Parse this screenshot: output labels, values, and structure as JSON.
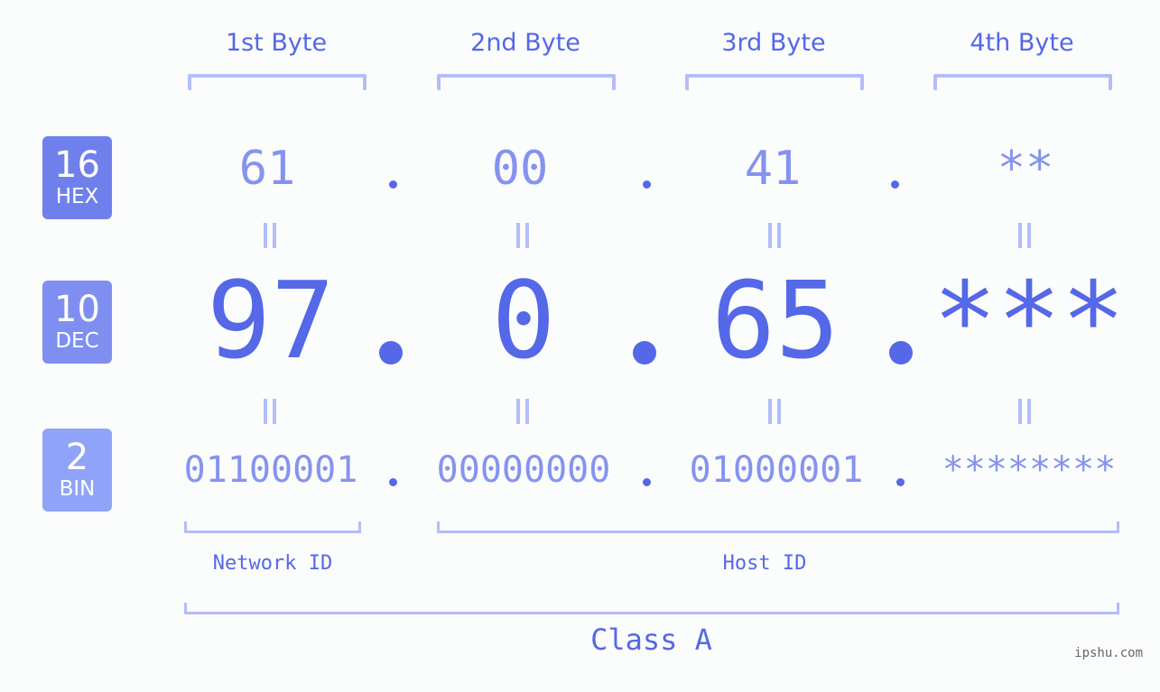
{
  "byte_headers": [
    "1st Byte",
    "2nd Byte",
    "3rd Byte",
    "4th Byte"
  ],
  "badges": {
    "hex": {
      "base": "16",
      "label": "HEX",
      "color": "#6f80ec"
    },
    "dec": {
      "base": "10",
      "label": "DEC",
      "color": "#7e8ff1"
    },
    "bin": {
      "base": "2",
      "label": "BIN",
      "color": "#8fa4f8"
    }
  },
  "hex_values": [
    "61",
    "00",
    "41",
    "**"
  ],
  "dec_values": [
    "97",
    "0",
    "65",
    "***"
  ],
  "bin_values": [
    "01100001",
    "00000000",
    "01000001",
    "********"
  ],
  "network_id_label": "Network ID",
  "host_id_label": "Host ID",
  "class_label": "Class A",
  "watermark": "ipshu.com",
  "colors": {
    "accent": "#5468e8",
    "light_value": "#8593ef",
    "bracket": "#b3bdf8",
    "background": "#fbfcfc"
  }
}
